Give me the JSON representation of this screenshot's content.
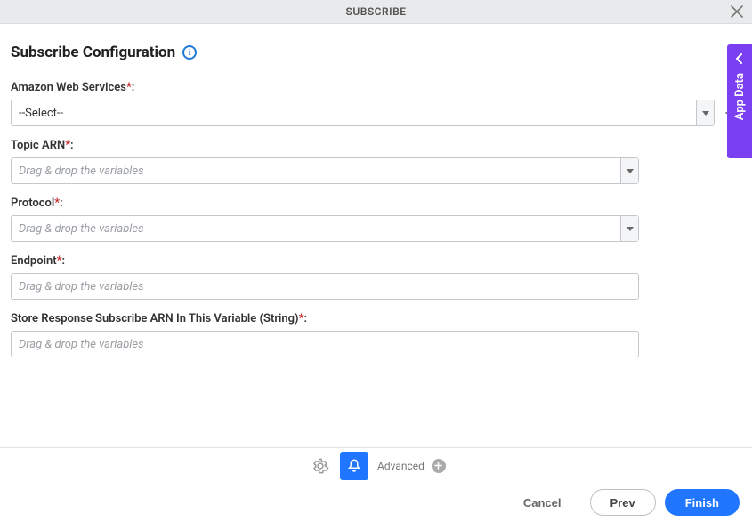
{
  "header": {
    "title": "SUBSCRIBE"
  },
  "page": {
    "title": "Subscribe Configuration"
  },
  "fields": {
    "aws": {
      "label": "Amazon Web Services",
      "value": "--Select--"
    },
    "topic_arn": {
      "label": "Topic ARN",
      "placeholder": "Drag & drop the variables"
    },
    "protocol": {
      "label": "Protocol",
      "placeholder": "Drag & drop the variables"
    },
    "endpoint": {
      "label": "Endpoint",
      "placeholder": "Drag & drop the variables"
    },
    "store_response": {
      "label": "Store Response Subscribe ARN In This Variable (String)",
      "placeholder": "Drag & drop the variables"
    }
  },
  "sidebar": {
    "label": "App Data"
  },
  "toolbar": {
    "advanced_label": "Advanced"
  },
  "footer": {
    "cancel": "Cancel",
    "prev": "Prev",
    "finish": "Finish"
  }
}
